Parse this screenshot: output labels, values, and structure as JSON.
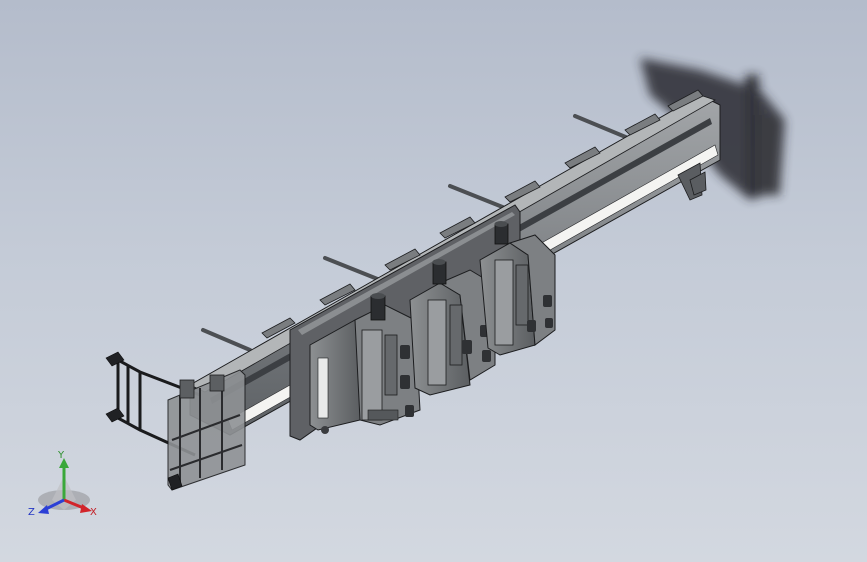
{
  "viewport": {
    "background_top": "#b4bccb",
    "background_bottom": "#d3d8e0"
  },
  "model": {
    "frame_color": "#8e9193",
    "rail_color": "#6f7378",
    "edge_color": "#1c1d1f",
    "stripe_color": "#f4f4f2",
    "panel_color": "#5f6165",
    "module_count": 3,
    "rod_count": 4,
    "shadow_present": true
  },
  "triad": {
    "x_label": "X",
    "y_label": "Y",
    "z_label": "Z",
    "x_color": "#d2242a",
    "y_color": "#3aa83a",
    "z_color": "#2b3fd6"
  }
}
